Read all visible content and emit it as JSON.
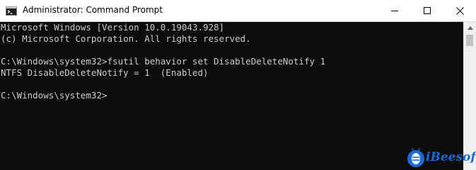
{
  "window": {
    "title": "Administrator: Command Prompt",
    "icon": "cmd-icon",
    "controls": {
      "minimize_icon": "minimize-icon",
      "maximize_icon": "maximize-icon",
      "close_icon": "close-icon"
    }
  },
  "console": {
    "background": "#0c0c0c",
    "foreground": "#cccccc",
    "lines": [
      "Microsoft Windows [Version 10.0.19043.928]",
      "(c) Microsoft Corporation. All rights reserved.",
      "",
      "C:\\Windows\\system32>fsutil behavior set DisableDeleteNotify 1",
      "NTFS DisableDeleteNotify = 1  (Enabled)",
      "",
      "C:\\Windows\\system32>"
    ]
  },
  "scrollbar": {
    "up_icon": "scroll-up-arrow-icon"
  },
  "watermark": {
    "text": "iBeesoft",
    "color": "#1a6bd8"
  }
}
